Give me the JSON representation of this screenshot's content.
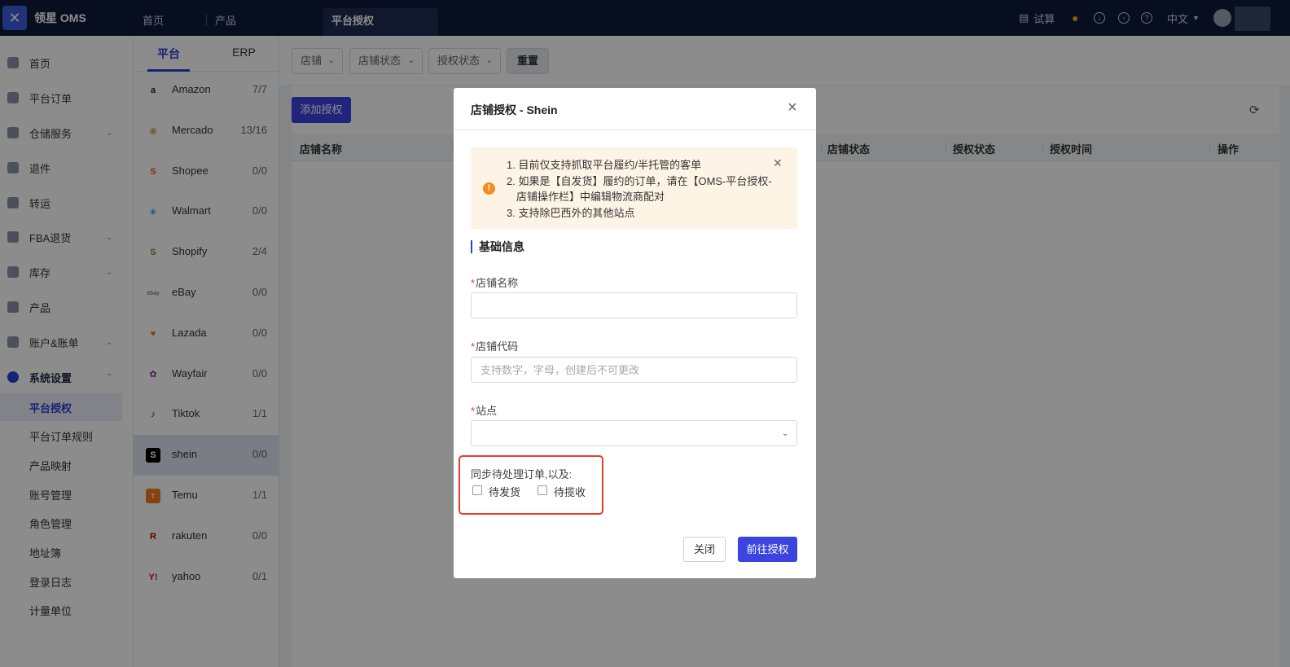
{
  "app": {
    "logo_glyph": "✕",
    "title": "领星 OMS"
  },
  "top_tabs": [
    "首页",
    "产品",
    "平台授权"
  ],
  "top_right": {
    "calc_label": "试算",
    "lang_label": "中文"
  },
  "sidebar": {
    "items": [
      {
        "label": "首页"
      },
      {
        "label": "平台订单"
      },
      {
        "label": "仓储服务",
        "chevron": "⌄"
      },
      {
        "label": "退件"
      },
      {
        "label": "转运"
      },
      {
        "label": "FBA退货",
        "chevron": "⌄"
      },
      {
        "label": "库存",
        "chevron": "⌄"
      },
      {
        "label": "产品"
      },
      {
        "label": "账户&账单",
        "chevron": "⌄"
      },
      {
        "label": "系统设置",
        "chevron": "⌃"
      }
    ],
    "sub_items": [
      "平台授权",
      "平台订单规则",
      "产品映射",
      "账号管理",
      "角色管理",
      "地址簿",
      "登录日志",
      "计量单位"
    ]
  },
  "platforms": {
    "tabs": [
      "平台",
      "ERP"
    ],
    "rows": [
      {
        "name": "Amazon",
        "count": "7/7",
        "glyph": "a",
        "color": "#222222"
      },
      {
        "name": "Mercado",
        "count": "13/16",
        "glyph": "◉",
        "color": "#c9b24a"
      },
      {
        "name": "Shopee",
        "count": "0/0",
        "glyph": "S",
        "color": "#ee4d2d"
      },
      {
        "name": "Walmart",
        "count": "0/0",
        "glyph": "✳",
        "color": "#0071ce"
      },
      {
        "name": "Shopify",
        "count": "2/4",
        "glyph": "S",
        "color": "#5e8e3e"
      },
      {
        "name": "eBay",
        "count": "0/0",
        "glyph": "ebay",
        "color": "#555555"
      },
      {
        "name": "Lazada",
        "count": "0/0",
        "glyph": "♥",
        "color": "#f36a21"
      },
      {
        "name": "Wayfair",
        "count": "0/0",
        "glyph": "✿",
        "color": "#7b2f8e"
      },
      {
        "name": "Tiktok",
        "count": "1/1",
        "glyph": "♪",
        "color": "#111111"
      },
      {
        "name": "shein",
        "count": "0/0",
        "glyph": "S",
        "color": "#000000"
      },
      {
        "name": "Temu",
        "count": "1/1",
        "glyph": "T",
        "color": "#f57a1f"
      },
      {
        "name": "rakuten",
        "count": "0/0",
        "glyph": "R",
        "color": "#bf0000"
      },
      {
        "name": "yahoo",
        "count": "0/1",
        "glyph": "Y!",
        "color": "#c8102e"
      }
    ]
  },
  "filters": {
    "shop": "店铺",
    "shop_status": "店铺状态",
    "auth_status": "授权状态",
    "reset": "重置"
  },
  "table": {
    "add_button": "添加授权",
    "headers": {
      "shop_name": "店铺名称",
      "shop_status": "店铺状态",
      "auth_status": "授权状态",
      "auth_time": "授权时间",
      "action": "操作"
    }
  },
  "modal": {
    "title": "店铺授权 - Shein",
    "alert_lines": [
      "1. 目前仅支持抓取平台履约/半托管的客单",
      "2. 如果是【自发货】履约的订单，请在【OMS-平台授权-店铺操作栏】中编辑物流商配对",
      "3. 支持除巴西外的其他站点"
    ],
    "section_title": "基础信息",
    "fields": {
      "shop_name": {
        "label": "店铺名称",
        "value": ""
      },
      "shop_code": {
        "label": "店铺代码",
        "placeholder": "支持数字，字母，创建后不可更改",
        "value": ""
      },
      "site": {
        "label": "站点",
        "value": ""
      }
    },
    "sync_label": "同步待处理订单,以及:",
    "checkboxes": [
      "待发货",
      "待揽收"
    ],
    "close_button": "关闭",
    "confirm_button": "前往授权"
  },
  "colors": {
    "primary": "#3b44e0",
    "topbar": "#0d1a3a",
    "warning_bg": "#fef4e6",
    "highlight_border": "#e33c2c"
  }
}
